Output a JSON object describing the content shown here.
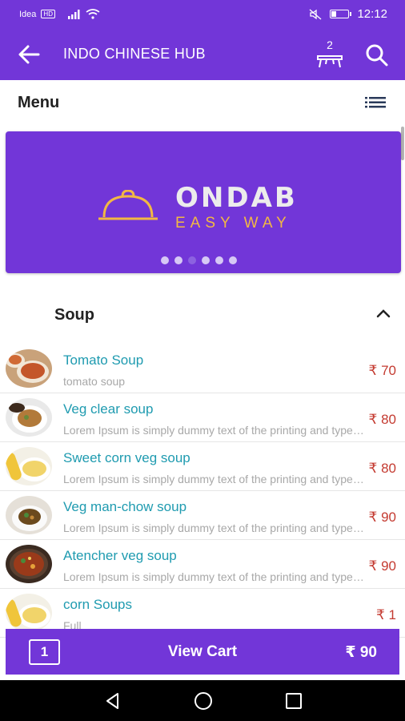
{
  "status_bar": {
    "carrier": "Idea",
    "network_badge": "HD",
    "time": "12:12"
  },
  "app_bar": {
    "title": "INDO CHINESE HUB",
    "table_count": "2"
  },
  "menu": {
    "title": "Menu"
  },
  "banner": {
    "brand_name": "ONDAB",
    "tagline": "EASY WAY",
    "slide_count": 6,
    "active_slide": 3
  },
  "category": {
    "title": "Soup"
  },
  "items": [
    {
      "name": "Tomato Soup",
      "description": "tomato soup",
      "price": "₹ 70",
      "image": "tomato-soup-thumbnail"
    },
    {
      "name": "Veg clear soup",
      "description": "Lorem Ipsum is simply dummy text of the printing and typesetting",
      "price": "₹ 80",
      "image": "veg-clear-soup-thumbnail"
    },
    {
      "name": "Sweet corn veg soup",
      "description": "Lorem Ipsum is simply dummy text of the printing and typesetting",
      "price": "₹ 80",
      "image": "sweet-corn-soup-thumbnail"
    },
    {
      "name": "Veg man-chow soup",
      "description": "Lorem Ipsum is simply dummy text of the printing and typesetting",
      "price": "₹ 90",
      "image": "manchow-soup-thumbnail"
    },
    {
      "name": "Atencher veg soup",
      "description": "Lorem Ipsum is simply dummy text of the printing and typesetting",
      "price": "₹ 90",
      "image": "atencher-soup-thumbnail"
    },
    {
      "name": "corn Soups",
      "description": "Full",
      "price": "₹ 1",
      "image": "corn-soup-thumbnail"
    }
  ],
  "cart": {
    "count": "1",
    "label": "View Cart",
    "total": "₹ 90"
  },
  "colors": {
    "primary": "#7236d8",
    "item_name": "#1f9bb0",
    "price": "#c43a30",
    "tagline": "#f2b843"
  }
}
